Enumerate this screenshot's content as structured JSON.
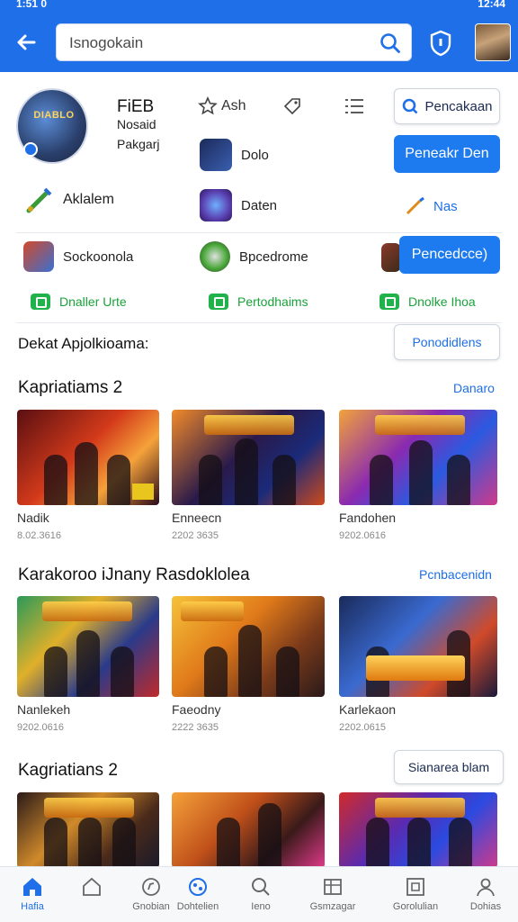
{
  "status_bar": {
    "time": "1:51 0",
    "right": "12:44"
  },
  "app_bar": {
    "search_placeholder": "Isnogokain"
  },
  "profile": {
    "logo": "DIABLO",
    "name": "FiEB",
    "sub1": "Nosaid",
    "sub2": "Pakgarj"
  },
  "top_actions": {
    "ash": "Ash",
    "pencakaan": "Pencakaan"
  },
  "menu": {
    "dolo": "Dolo",
    "pencarir_den": "Peneakr Den",
    "aklalem": "Aklalem",
    "daten": "Daten",
    "nas": "Nas",
    "sockoonola": "Sockoonola",
    "bpcedrome": "Bpcedrome",
    "pencedcce": "Pencedcce)"
  },
  "green_links": [
    "Dnaller Urte",
    "Pertodhaims",
    "Dnolke Ihoa"
  ],
  "dekat": {
    "title": "Dekat Apjolkioama:",
    "button": "Ponodidlens"
  },
  "sections": [
    {
      "title": "Kapriatiams 2",
      "link": "Danaro",
      "cards": [
        {
          "title": "Nadik",
          "meta": "8.02.3616"
        },
        {
          "title": "Enneecn",
          "meta": "2202 3635"
        },
        {
          "title": "Fandohen",
          "meta": "9202.0616"
        }
      ]
    },
    {
      "title": "Karakoroo iJnany Rasdoklolea",
      "link": "Pcnbacenidn",
      "cards": [
        {
          "title": "Nanlekeh",
          "meta": "9202.0616"
        },
        {
          "title": "Faeodny",
          "meta": "2222 3635"
        },
        {
          "title": "Karlekaon",
          "meta": "2202.0615"
        }
      ]
    },
    {
      "title": "Kagriatians 2",
      "link": "Sianarea blam",
      "cards": [
        {},
        {},
        {}
      ]
    }
  ],
  "bottom_nav": [
    {
      "label": "Hafia",
      "icon": "home-icon",
      "active": true
    },
    {
      "label": "",
      "icon": "house-outline-icon",
      "active": false
    },
    {
      "label": "Gnobian",
      "icon": "discover-icon",
      "active": false
    },
    {
      "label": "Dohtelien",
      "icon": "games-icon",
      "active": false
    },
    {
      "label": "Ieno",
      "icon": "search-icon",
      "active": false
    },
    {
      "label": "Gsmzagar",
      "icon": "library-icon",
      "active": false
    },
    {
      "label": "Gorolulian",
      "icon": "apps-icon",
      "active": false
    },
    {
      "label": "Dohias",
      "icon": "profile-icon",
      "active": false
    }
  ],
  "colors": {
    "brand": "#1e6fe8",
    "green": "#22b24c"
  }
}
